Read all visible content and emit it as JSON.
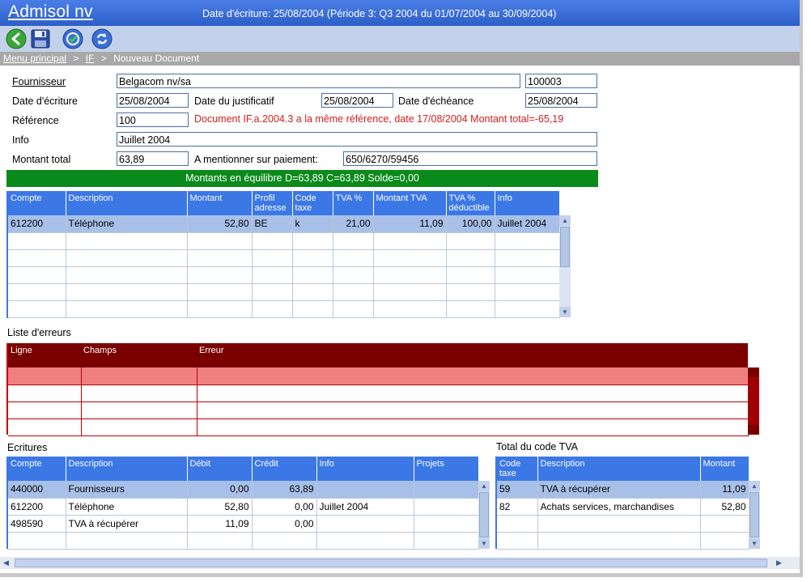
{
  "app": {
    "title": "Admisol nv",
    "date_info": "Date d'écriture: 25/08/2004 (Période 3: Q3 2004 du 01/07/2004 au 30/09/2004)"
  },
  "toolbar": {
    "icons": [
      "back-icon",
      "save-icon",
      "validate-icon",
      "refresh-icon"
    ]
  },
  "breadcrumb": {
    "items": [
      "Menu principal",
      "IF",
      "Nouveau Document"
    ],
    "separator": ">"
  },
  "form": {
    "fournisseur_label": "Fournisseur",
    "fournisseur_value": "Belgacom nv/sa",
    "fournisseur_code": "100003",
    "date_ecriture_label": "Date d'écriture",
    "date_ecriture_value": "25/08/2004",
    "date_justificatif_label": "Date du justificatif",
    "date_justificatif_value": "25/08/2004",
    "date_echeance_label": "Date d'échéance",
    "date_echeance_value": "25/08/2004",
    "reference_label": "Référence",
    "reference_value": "100",
    "reference_warning": "Document IF.a.2004.3  a la même référence, date 17/08/2004 Montant total=-65,19",
    "info_label": "Info",
    "info_value": "Juillet 2004",
    "montant_total_label": "Montant total",
    "montant_total_value": "63,89",
    "mention_label": "A mentionner sur paiement:",
    "mention_value": "650/6270/59456"
  },
  "balance": {
    "text": "Montants en équilibre D=63,89 C=63,89 Solde=0,00",
    "color": "#0a8a1a"
  },
  "lines": {
    "headers": [
      "Compte",
      "Description",
      "Montant",
      "Profil adresse",
      "Code taxe",
      "TVA %",
      "Montant TVA",
      "TVA % déductible",
      "Info"
    ],
    "rows": [
      [
        "612200",
        "Téléphone",
        "52,80",
        "BE",
        "k",
        "21,00",
        "11,09",
        "100,00",
        "Juillet 2004"
      ]
    ]
  },
  "errors": {
    "title": "Liste d'erreurs",
    "headers": [
      "Ligne",
      "Champs",
      "Erreur"
    ],
    "color": "#7a0000"
  },
  "ecritures": {
    "title": "Ecritures",
    "headers": [
      "Compte",
      "Description",
      "Débit",
      "Crédit",
      "Info",
      "Projets"
    ],
    "rows": [
      [
        "440000",
        "Fournisseurs",
        "0,00",
        "63,89",
        "",
        ""
      ],
      [
        "612200",
        "Téléphone",
        "52,80",
        "0,00",
        "Juillet 2004",
        ""
      ],
      [
        "498590",
        "TVA à récupérer",
        "11,09",
        "0,00",
        "",
        ""
      ]
    ]
  },
  "tva_totals": {
    "title": "Total du code TVA",
    "headers": [
      "Code taxe",
      "Description",
      "Montant"
    ],
    "rows": [
      [
        "59",
        "TVA à récupérer",
        "11,09"
      ],
      [
        "82",
        "Achats services, marchandises",
        "52,80"
      ]
    ]
  }
}
